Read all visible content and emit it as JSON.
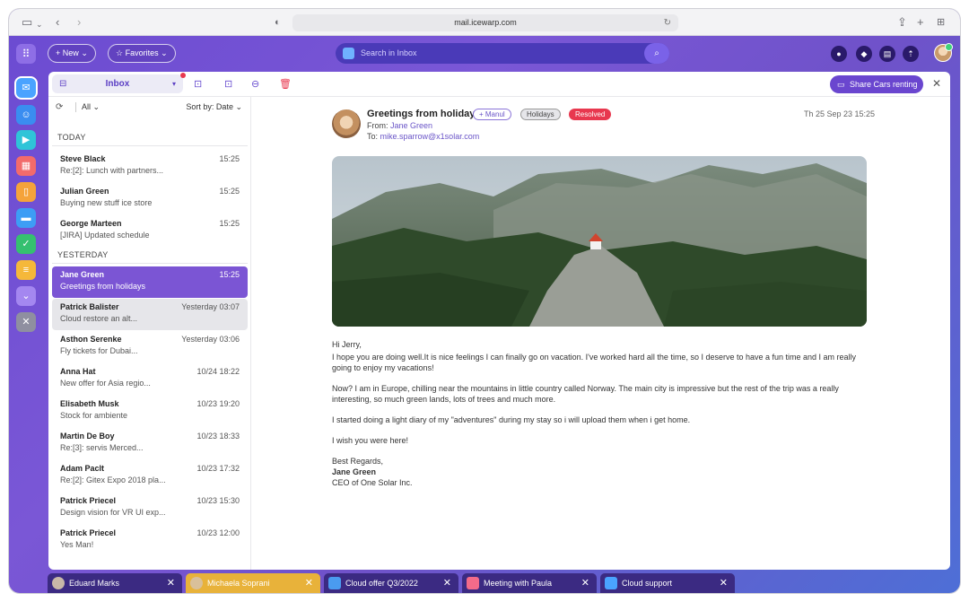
{
  "browser": {
    "url": "mail.icewarp.com"
  },
  "topbar": {
    "new_label": "New",
    "favorites_label": "Favorites",
    "search_placeholder": "Search in Inbox"
  },
  "toolbar": {
    "folder": "Inbox",
    "share_label": "Share Cars renting"
  },
  "list": {
    "filter": "All",
    "sort": "Sort by: Date",
    "sections": {
      "today": "TODAY",
      "yesterday": "YESTERDAY"
    },
    "today": [
      {
        "from": "Steve Black",
        "subject": "Re:[2]: Lunch with partners...",
        "time": "15:25"
      },
      {
        "from": "Julian Green",
        "subject": "Buying new stuff ice store",
        "time": "15:25"
      },
      {
        "from": "George Marteen",
        "subject": "[JIRA] Updated schedule",
        "time": "15:25"
      }
    ],
    "yesterday": [
      {
        "from": "Jane Green",
        "subject": "Greetings from holidays",
        "time": "15:25"
      },
      {
        "from": "Patrick Balister",
        "subject": "Cloud restore an alt...",
        "time": "Yesterday 03:07"
      },
      {
        "from": "Asthon Serenke",
        "subject": "Fly tickets for Dubai...",
        "time": "Yesterday 03:06"
      },
      {
        "from": "Anna Hat",
        "subject": "New offer for Asia regio...",
        "time": "10/24 18:22"
      },
      {
        "from": "Elisabeth Musk",
        "subject": "Stock for ambiente",
        "time": "10/23 19:20"
      },
      {
        "from": "Martin De Boy",
        "subject": "Re:[3]: servis Merced...",
        "time": "10/23 18:33"
      },
      {
        "from": "Adam Paclt",
        "subject": "Re:[2]: Gitex Expo 2018 pla...",
        "time": "10/23 17:32"
      },
      {
        "from": "Patrick Priecel",
        "subject": "Design vision for VR UI exp...",
        "time": "10/23 15:30"
      },
      {
        "from": "Patrick Priecel",
        "subject": "Yes Man!",
        "time": "10/23 12:00"
      }
    ]
  },
  "message": {
    "subject": "Greetings from holidays",
    "tags": [
      "+ Manul",
      "Holidays",
      "Resolved"
    ],
    "from_prefix": "From:",
    "from_name": "Jane Green",
    "to_prefix": "To:",
    "to_address": "mike.sparrow@x1solar.com",
    "date": "Th 25 Sep 23 15:25",
    "greeting": "Hi Jerry,",
    "p1": "I hope you are doing well.It is nice feelings I can finally go on vacation. I've worked hard all the time, so I deserve to have a fun time and I am really going to enjoy my vacations!",
    "p2": "Now? I am in Europe, chilling near the mountains in little country called Norway. The main city is impressive but the rest of the trip was a really interesting, so much green lands, lots of trees and much more.",
    "p3": "I started doing a light diary of my \"adventures\" during my stay so i will upload them when i get home.",
    "p4": "I wish you were here!",
    "closing": "Best Regards,",
    "sig_name": "Jane Green",
    "sig_title": "CEO of One Solar Inc."
  },
  "taskbar": [
    {
      "label": "Eduard Marks"
    },
    {
      "label": "Michaela Soprani"
    },
    {
      "label": "Cloud offer Q3/2022"
    },
    {
      "label": "Meeting with Paula"
    },
    {
      "label": "Cloud support"
    }
  ]
}
